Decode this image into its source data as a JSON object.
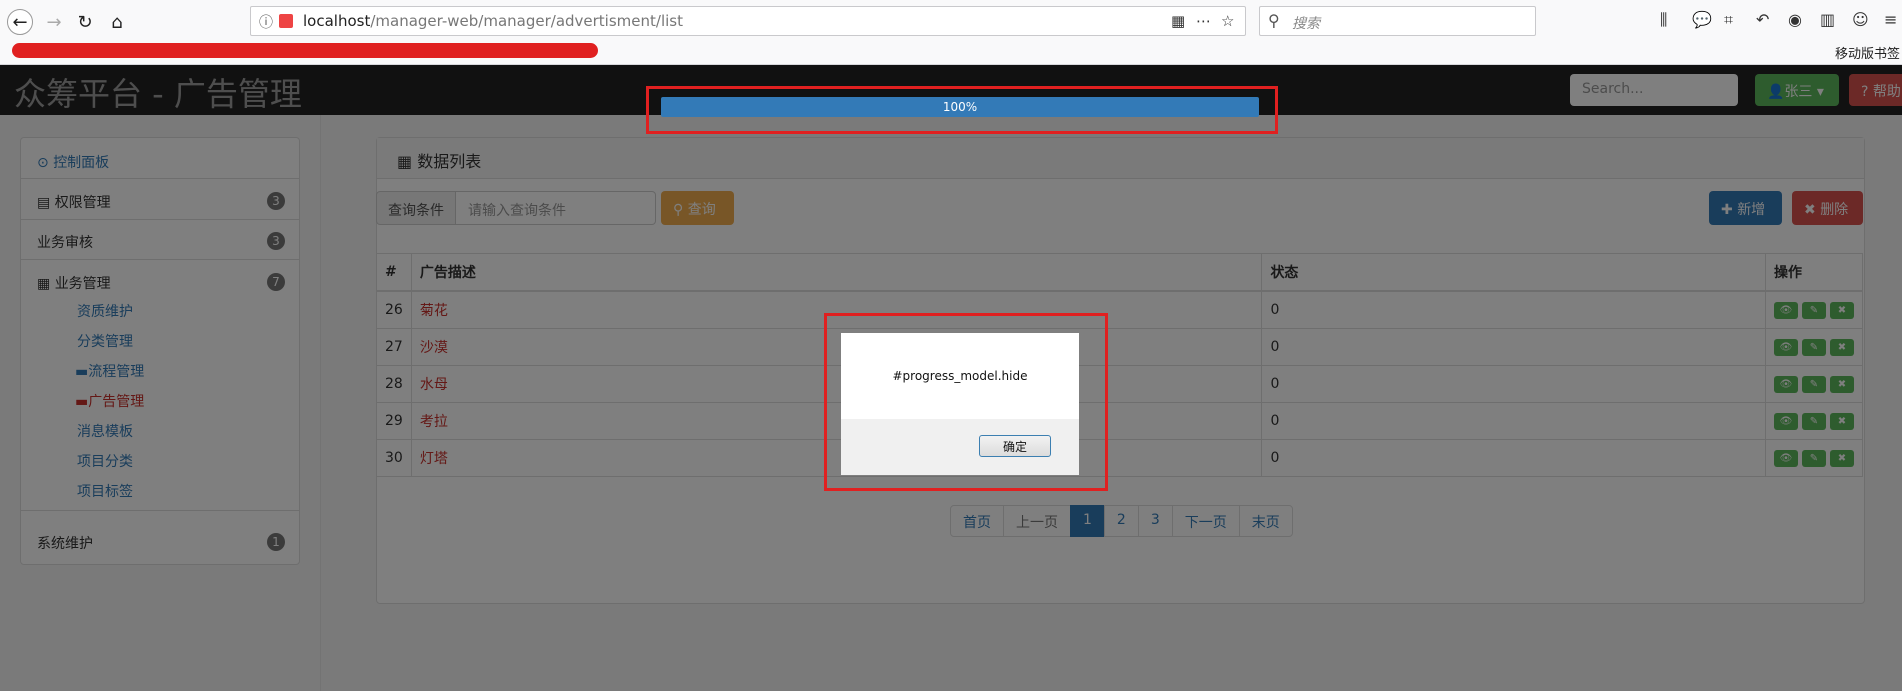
{
  "browser": {
    "url_host": "localhost",
    "url_path": "/manager-web/manager/advertisment/list",
    "search_placeholder": "搜索",
    "mobile_bookmark": "移动版书签"
  },
  "header": {
    "brand": "众筹平台 - 广告管理",
    "search_placeholder": "Search...",
    "user_label": "张三",
    "help_label": "帮助"
  },
  "sidebar": {
    "dashboard": "控制面板",
    "items": [
      {
        "label": "权限管理",
        "badge": "3"
      },
      {
        "label": "业务审核",
        "badge": "3"
      },
      {
        "label": "业务管理",
        "badge": "7"
      },
      {
        "label": "系统维护",
        "badge": "1"
      }
    ],
    "subitems": [
      "资质维护",
      "分类管理",
      "流程管理",
      "广告管理",
      "消息模板",
      "项目分类",
      "项目标签"
    ]
  },
  "main": {
    "panel_title": "数据列表",
    "query_addon": "查询条件",
    "query_placeholder": "请输入查询条件",
    "query_button": "查询",
    "add_button": "新增",
    "delete_button": "删除",
    "table": {
      "headers": [
        "#",
        "广告描述",
        "状态",
        "操作"
      ],
      "rows": [
        {
          "id": "26",
          "desc": "菊花",
          "status": "0"
        },
        {
          "id": "27",
          "desc": "沙漠",
          "status": "0"
        },
        {
          "id": "28",
          "desc": "水母",
          "status": "0"
        },
        {
          "id": "29",
          "desc": "考拉",
          "status": "0"
        },
        {
          "id": "30",
          "desc": "灯塔",
          "status": "0"
        }
      ]
    },
    "pager": [
      "首页",
      "上一页",
      "1",
      "2",
      "3",
      "下一页",
      "末页"
    ]
  },
  "progress": {
    "label": "100%",
    "value": 1.0
  },
  "alert": {
    "message": "#progress_model.hide",
    "ok": "确定"
  },
  "colors": {
    "accent": "#337ab7",
    "danger": "#d9534f",
    "success": "#5cb85c",
    "warning": "#f0ad4e",
    "highlight": "#e02020"
  }
}
